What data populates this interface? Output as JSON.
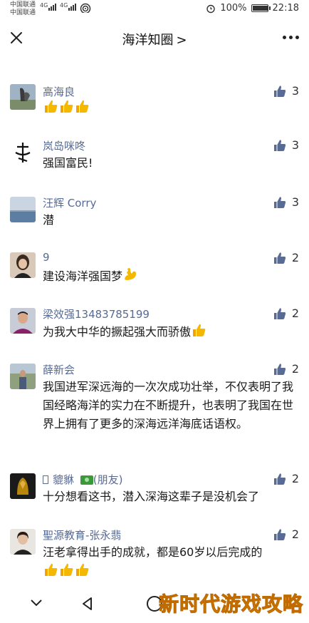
{
  "status_bar": {
    "carrier_1": "中国联通",
    "carrier_2": "中国联通",
    "net_1": "4G",
    "net_2": "4G",
    "battery_text": "100%",
    "battery_level": 1.0,
    "time": "22:18"
  },
  "header": {
    "title": "海洋知圈",
    "title_chevron": ">"
  },
  "comments": [
    {
      "name": "高海良",
      "text": "",
      "emoji_count": 3,
      "likes": "3"
    },
    {
      "name": "岚岛咪咚",
      "text": "强国富民!",
      "emoji_count": 0,
      "likes": "3"
    },
    {
      "name": "汪辉 Corry",
      "text": "潜",
      "emoji_count": 0,
      "likes": "3"
    },
    {
      "name": "9",
      "text": "建设海洋强国梦",
      "emoji": "muscle",
      "likes": "2"
    },
    {
      "name": "梁效强13483785199",
      "text": "为我大中华的撅起强大而骄傲",
      "emoji": "thumbs-up",
      "likes": "2"
    },
    {
      "name": "薛新会",
      "text": "我国进军深远海的一次次成功壮举，不仅表明了我国经略海洋的实力在不断提升，也表明了我国在世界上拥有了更多的深海远洋海底话语权。",
      "likes": "2"
    },
    {
      "name": "貔貅",
      "name_suffix": "(朋友)",
      "text": "十分想看这书，潜入深海这辈子是没机会了",
      "likes": "2"
    },
    {
      "name": "聖源教育-张永翡",
      "text": "汪老拿得出手的成就，都是60岁以后完成的",
      "emoji_count": 3,
      "likes": "2"
    }
  ],
  "watermark": "新时代游戏攻略",
  "colors": {
    "name_blue": "#576b95",
    "like_blue": "#576b95",
    "emoji_yellow": "#f5b800"
  }
}
